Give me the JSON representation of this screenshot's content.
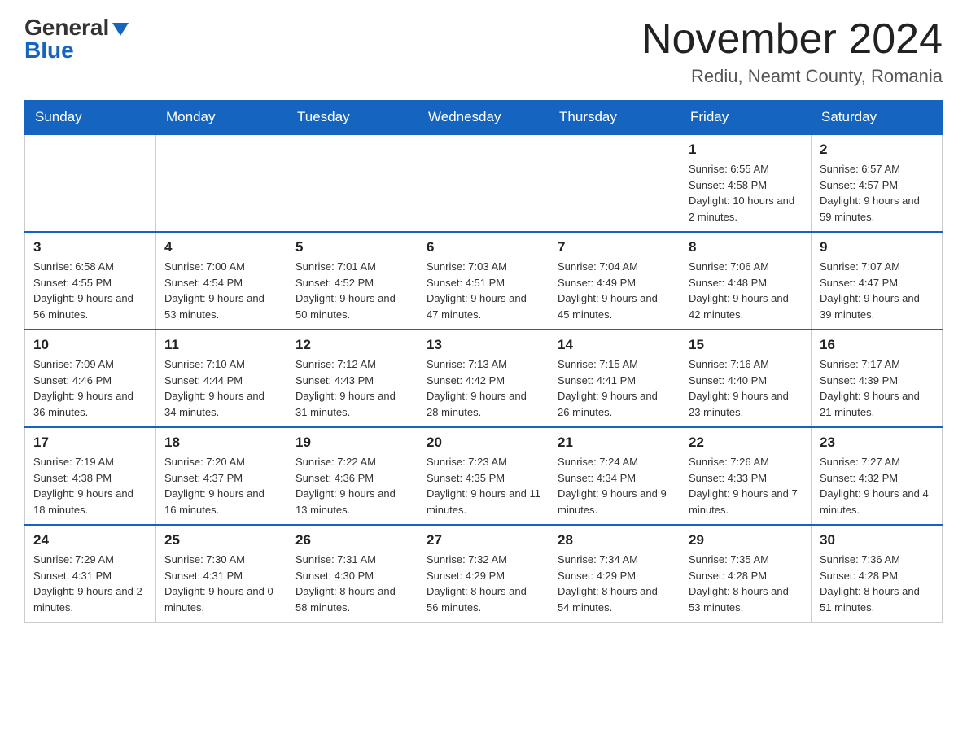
{
  "logo": {
    "general": "General",
    "blue": "Blue"
  },
  "title": "November 2024",
  "location": "Rediu, Neamt County, Romania",
  "days_of_week": [
    "Sunday",
    "Monday",
    "Tuesday",
    "Wednesday",
    "Thursday",
    "Friday",
    "Saturday"
  ],
  "weeks": [
    [
      {
        "day": "",
        "info": ""
      },
      {
        "day": "",
        "info": ""
      },
      {
        "day": "",
        "info": ""
      },
      {
        "day": "",
        "info": ""
      },
      {
        "day": "",
        "info": ""
      },
      {
        "day": "1",
        "info": "Sunrise: 6:55 AM\nSunset: 4:58 PM\nDaylight: 10 hours and 2 minutes."
      },
      {
        "day": "2",
        "info": "Sunrise: 6:57 AM\nSunset: 4:57 PM\nDaylight: 9 hours and 59 minutes."
      }
    ],
    [
      {
        "day": "3",
        "info": "Sunrise: 6:58 AM\nSunset: 4:55 PM\nDaylight: 9 hours and 56 minutes."
      },
      {
        "day": "4",
        "info": "Sunrise: 7:00 AM\nSunset: 4:54 PM\nDaylight: 9 hours and 53 minutes."
      },
      {
        "day": "5",
        "info": "Sunrise: 7:01 AM\nSunset: 4:52 PM\nDaylight: 9 hours and 50 minutes."
      },
      {
        "day": "6",
        "info": "Sunrise: 7:03 AM\nSunset: 4:51 PM\nDaylight: 9 hours and 47 minutes."
      },
      {
        "day": "7",
        "info": "Sunrise: 7:04 AM\nSunset: 4:49 PM\nDaylight: 9 hours and 45 minutes."
      },
      {
        "day": "8",
        "info": "Sunrise: 7:06 AM\nSunset: 4:48 PM\nDaylight: 9 hours and 42 minutes."
      },
      {
        "day": "9",
        "info": "Sunrise: 7:07 AM\nSunset: 4:47 PM\nDaylight: 9 hours and 39 minutes."
      }
    ],
    [
      {
        "day": "10",
        "info": "Sunrise: 7:09 AM\nSunset: 4:46 PM\nDaylight: 9 hours and 36 minutes."
      },
      {
        "day": "11",
        "info": "Sunrise: 7:10 AM\nSunset: 4:44 PM\nDaylight: 9 hours and 34 minutes."
      },
      {
        "day": "12",
        "info": "Sunrise: 7:12 AM\nSunset: 4:43 PM\nDaylight: 9 hours and 31 minutes."
      },
      {
        "day": "13",
        "info": "Sunrise: 7:13 AM\nSunset: 4:42 PM\nDaylight: 9 hours and 28 minutes."
      },
      {
        "day": "14",
        "info": "Sunrise: 7:15 AM\nSunset: 4:41 PM\nDaylight: 9 hours and 26 minutes."
      },
      {
        "day": "15",
        "info": "Sunrise: 7:16 AM\nSunset: 4:40 PM\nDaylight: 9 hours and 23 minutes."
      },
      {
        "day": "16",
        "info": "Sunrise: 7:17 AM\nSunset: 4:39 PM\nDaylight: 9 hours and 21 minutes."
      }
    ],
    [
      {
        "day": "17",
        "info": "Sunrise: 7:19 AM\nSunset: 4:38 PM\nDaylight: 9 hours and 18 minutes."
      },
      {
        "day": "18",
        "info": "Sunrise: 7:20 AM\nSunset: 4:37 PM\nDaylight: 9 hours and 16 minutes."
      },
      {
        "day": "19",
        "info": "Sunrise: 7:22 AM\nSunset: 4:36 PM\nDaylight: 9 hours and 13 minutes."
      },
      {
        "day": "20",
        "info": "Sunrise: 7:23 AM\nSunset: 4:35 PM\nDaylight: 9 hours and 11 minutes."
      },
      {
        "day": "21",
        "info": "Sunrise: 7:24 AM\nSunset: 4:34 PM\nDaylight: 9 hours and 9 minutes."
      },
      {
        "day": "22",
        "info": "Sunrise: 7:26 AM\nSunset: 4:33 PM\nDaylight: 9 hours and 7 minutes."
      },
      {
        "day": "23",
        "info": "Sunrise: 7:27 AM\nSunset: 4:32 PM\nDaylight: 9 hours and 4 minutes."
      }
    ],
    [
      {
        "day": "24",
        "info": "Sunrise: 7:29 AM\nSunset: 4:31 PM\nDaylight: 9 hours and 2 minutes."
      },
      {
        "day": "25",
        "info": "Sunrise: 7:30 AM\nSunset: 4:31 PM\nDaylight: 9 hours and 0 minutes."
      },
      {
        "day": "26",
        "info": "Sunrise: 7:31 AM\nSunset: 4:30 PM\nDaylight: 8 hours and 58 minutes."
      },
      {
        "day": "27",
        "info": "Sunrise: 7:32 AM\nSunset: 4:29 PM\nDaylight: 8 hours and 56 minutes."
      },
      {
        "day": "28",
        "info": "Sunrise: 7:34 AM\nSunset: 4:29 PM\nDaylight: 8 hours and 54 minutes."
      },
      {
        "day": "29",
        "info": "Sunrise: 7:35 AM\nSunset: 4:28 PM\nDaylight: 8 hours and 53 minutes."
      },
      {
        "day": "30",
        "info": "Sunrise: 7:36 AM\nSunset: 4:28 PM\nDaylight: 8 hours and 51 minutes."
      }
    ]
  ]
}
